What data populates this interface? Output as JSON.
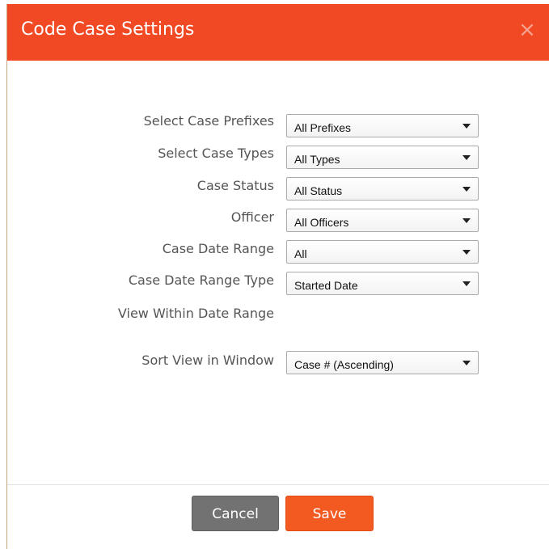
{
  "dialog": {
    "title": "Code Case Settings",
    "close_icon": "close-icon",
    "accent_color": "#f04924"
  },
  "fields": [
    {
      "label": "Select Case Prefixes",
      "value": "All Prefixes"
    },
    {
      "label": "Select Case Types",
      "value": "All Types"
    },
    {
      "label": "Case Status",
      "value": "All Status"
    },
    {
      "label": "Officer",
      "value": "All Officers"
    },
    {
      "label": "Case Date Range",
      "value": "All"
    },
    {
      "label": "Case Date Range Type",
      "value": "Started Date"
    },
    {
      "label": "View Within Date Range"
    },
    {
      "label": "Sort View in Window",
      "value": "Case # (Ascending)"
    }
  ],
  "footer": {
    "cancel_label": "Cancel",
    "save_label": "Save",
    "cancel_color": "#727272",
    "save_color": "#f25a22"
  }
}
